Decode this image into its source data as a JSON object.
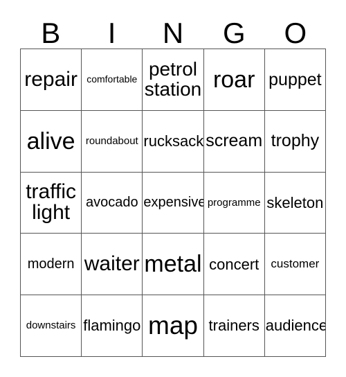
{
  "card": {
    "header_letters": [
      "B",
      "I",
      "N",
      "G",
      "O"
    ],
    "rows": [
      [
        {
          "text": "repair",
          "size": "fs-xxl"
        },
        {
          "text": "comfortable",
          "size": "fs-xxs"
        },
        {
          "text": "petrol station",
          "size": "fs-xl",
          "wrap": true
        },
        {
          "text": "roar",
          "size": "fs-3xl"
        },
        {
          "text": "puppet",
          "size": "fs-l"
        }
      ],
      [
        {
          "text": "alive",
          "size": "fs-3xl"
        },
        {
          "text": "roundabout",
          "size": "fs-xs"
        },
        {
          "text": "rucksack",
          "size": "fs-ml"
        },
        {
          "text": "scream",
          "size": "fs-l"
        },
        {
          "text": "trophy",
          "size": "fs-l"
        }
      ],
      [
        {
          "text": "traffic light",
          "size": "fs-xxl",
          "wrap": true
        },
        {
          "text": "avocado",
          "size": "fs-m"
        },
        {
          "text": "expensive",
          "size": "fs-m"
        },
        {
          "text": "programme",
          "size": "fs-xs"
        },
        {
          "text": "skeleton",
          "size": "fs-ml"
        }
      ],
      [
        {
          "text": "modern",
          "size": "fs-m"
        },
        {
          "text": "waiter",
          "size": "fs-xxl"
        },
        {
          "text": "metal",
          "size": "fs-3xl"
        },
        {
          "text": "concert",
          "size": "fs-ml"
        },
        {
          "text": "customer",
          "size": "fs-s"
        }
      ],
      [
        {
          "text": "downstairs",
          "size": "fs-xs"
        },
        {
          "text": "flamingo",
          "size": "fs-ml"
        },
        {
          "text": "map",
          "size": "fs-4xl"
        },
        {
          "text": "trainers",
          "size": "fs-ml"
        },
        {
          "text": "audience",
          "size": "fs-ml"
        }
      ]
    ]
  },
  "colors": {
    "grid_line": "#555555",
    "text": "#000000",
    "background": "#ffffff"
  }
}
